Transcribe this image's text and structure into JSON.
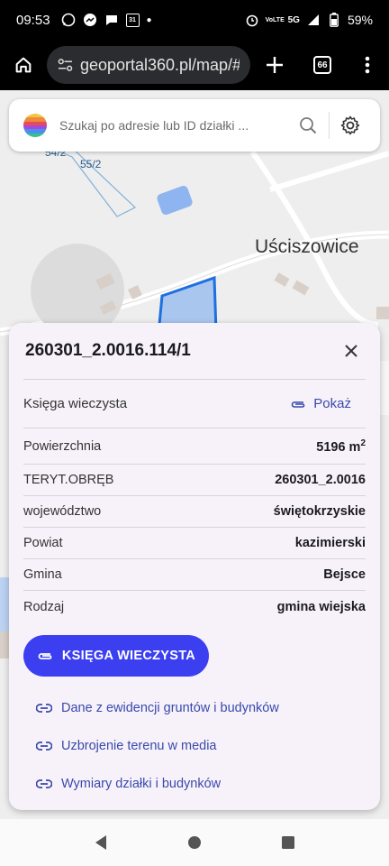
{
  "status_bar": {
    "time": "09:53",
    "calendar_day": "31",
    "lte_label": "VoLTE",
    "network": "5G",
    "battery": "59%"
  },
  "browser": {
    "url": "geoportal360.pl/map/#c",
    "tabs_count": "66"
  },
  "search": {
    "placeholder": "Szukaj po adresie lub ID działki ..."
  },
  "map": {
    "place_name": "Uściszowice",
    "parcel_labels": [
      "54/2",
      "55/2"
    ]
  },
  "panel": {
    "title": "260301_2.0016.114/1",
    "land_register_label": "Księga wieczysta",
    "show_link_label": "Pokaż",
    "rows": [
      {
        "label": "Powierzchnia",
        "value": "5196 m",
        "sup": "2"
      },
      {
        "label": "TERYT.OBRĘB",
        "value": "260301_2.0016"
      },
      {
        "label": "województwo",
        "value": "świętokrzyskie"
      },
      {
        "label": "Powiat",
        "value": "kazimierski"
      },
      {
        "label": "Gmina",
        "value": "Bejsce"
      },
      {
        "label": "Rodzaj",
        "value": "gmina wiejska"
      }
    ],
    "primary_button_label": "KSIĘGA WIECZYSTA",
    "links": [
      "Dane z ewidencji gruntów i budynków",
      "Uzbrojenie terenu w media",
      "Wymiary działki i budynków"
    ]
  },
  "colors": {
    "accent": "#3b3ff0",
    "link": "#3949ab",
    "parcel_fill": "#a9c6ee",
    "parcel_stroke": "#1e6fe0"
  }
}
